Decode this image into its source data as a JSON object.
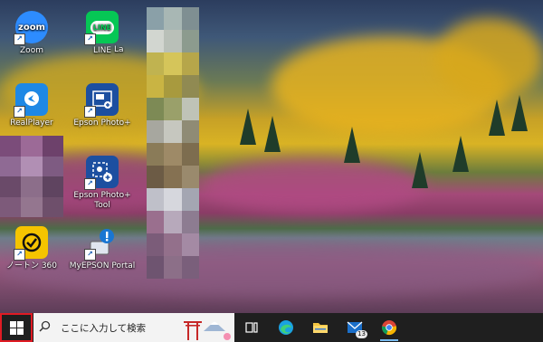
{
  "desktop": {
    "icons": [
      {
        "label": "Zoom",
        "glyph": "zoom",
        "bg": "#2d8cff",
        "icon": "zoom-icon"
      },
      {
        "label": "LINE",
        "glyph": "LINE",
        "bg": "#06c755",
        "icon": "line-icon"
      },
      {
        "label": "La",
        "glyph": "",
        "bg": "",
        "icon": "blurred-icon"
      },
      {
        "label": "RealPlayer",
        "glyph": "",
        "bg": "#1e88e5",
        "icon": "realplayer-icon"
      },
      {
        "label": "Epson Photo+",
        "glyph": "",
        "bg": "#1c4fa0",
        "icon": "epson-photo-icon"
      },
      {
        "label": "Epson Photo+ Tool",
        "glyph": "",
        "bg": "#1c4fa0",
        "icon": "epson-photo-tool-icon"
      },
      {
        "label": "ノートン 360",
        "glyph": "",
        "bg": "#f5c400",
        "icon": "norton-icon"
      },
      {
        "label": "MyEPSON Portal",
        "glyph": "",
        "bg": "#1976d2",
        "icon": "myepson-icon"
      }
    ]
  },
  "taskbar": {
    "search_placeholder": "ここに入力して検索",
    "mail_badge": "13",
    "accent": "#e01b24"
  }
}
